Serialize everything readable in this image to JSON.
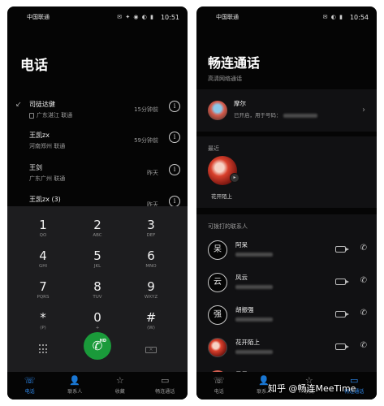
{
  "left": {
    "status": {
      "carrier": "中国联通",
      "icons": "✉ ✦ ◉ ◐ ▮",
      "time": "10:51"
    },
    "title": "电话",
    "calls": [
      {
        "name": "司徒达健",
        "location": "广东湛江 联通",
        "ago": "15分钟前",
        "sim": true
      },
      {
        "name": "王凯zx",
        "location": "河南郑州 联通",
        "ago": "59分钟前",
        "sim": false
      },
      {
        "name": "王剑",
        "location": "广东广州 联通",
        "ago": "昨天",
        "sim": false
      },
      {
        "name": "王凯zx (3)",
        "location": "",
        "ago": "昨天",
        "sim": false
      }
    ],
    "keys": [
      {
        "digit": "1",
        "letters": "QO"
      },
      {
        "digit": "2",
        "letters": "ABC"
      },
      {
        "digit": "3",
        "letters": "DEF"
      },
      {
        "digit": "4",
        "letters": "GHI"
      },
      {
        "digit": "5",
        "letters": "JKL"
      },
      {
        "digit": "6",
        "letters": "MNO"
      },
      {
        "digit": "7",
        "letters": "PQRS"
      },
      {
        "digit": "8",
        "letters": "TUV"
      },
      {
        "digit": "9",
        "letters": "WXYZ"
      },
      {
        "digit": "*",
        "letters": "(P)"
      },
      {
        "digit": "0",
        "letters": "+"
      },
      {
        "digit": "#",
        "letters": "(W)"
      }
    ],
    "hd_label": "HD",
    "nav": [
      {
        "label": "电话",
        "icon": "☏",
        "active": true
      },
      {
        "label": "联系人",
        "icon": "👤",
        "active": false
      },
      {
        "label": "收藏",
        "icon": "☆",
        "active": false
      },
      {
        "label": "畅连通话",
        "icon": "▭",
        "active": false
      }
    ]
  },
  "right": {
    "status": {
      "carrier": "中国联通",
      "icons": "✉ ◐ ▮",
      "time": "10:54"
    },
    "title": "畅连通话",
    "subtitle": "高清网络通话",
    "me": {
      "name": "摩尔",
      "status": "已开启，用于号码："
    },
    "recent_label": "最近",
    "recent": [
      {
        "name": "花开陌上"
      }
    ],
    "contacts_label": "可拨打的联系人",
    "contacts": [
      {
        "letter": "呆",
        "name": "阿呆",
        "kind": "letter"
      },
      {
        "letter": "云",
        "name": "风云",
        "kind": "letter"
      },
      {
        "letter": "强",
        "name": "胡振强",
        "kind": "letter"
      },
      {
        "letter": "",
        "name": "花开陌上",
        "kind": "flower"
      },
      {
        "letter": "",
        "name": "晨晨",
        "kind": "person"
      }
    ],
    "nav": [
      {
        "label": "电话",
        "icon": "☏",
        "active": false
      },
      {
        "label": "联系人",
        "icon": "👤",
        "active": false
      },
      {
        "label": "收藏",
        "icon": "☆",
        "active": false
      },
      {
        "label": "畅连通话",
        "icon": "▭",
        "active": true
      }
    ]
  },
  "watermark": "知乎 @畅连MeeTime"
}
